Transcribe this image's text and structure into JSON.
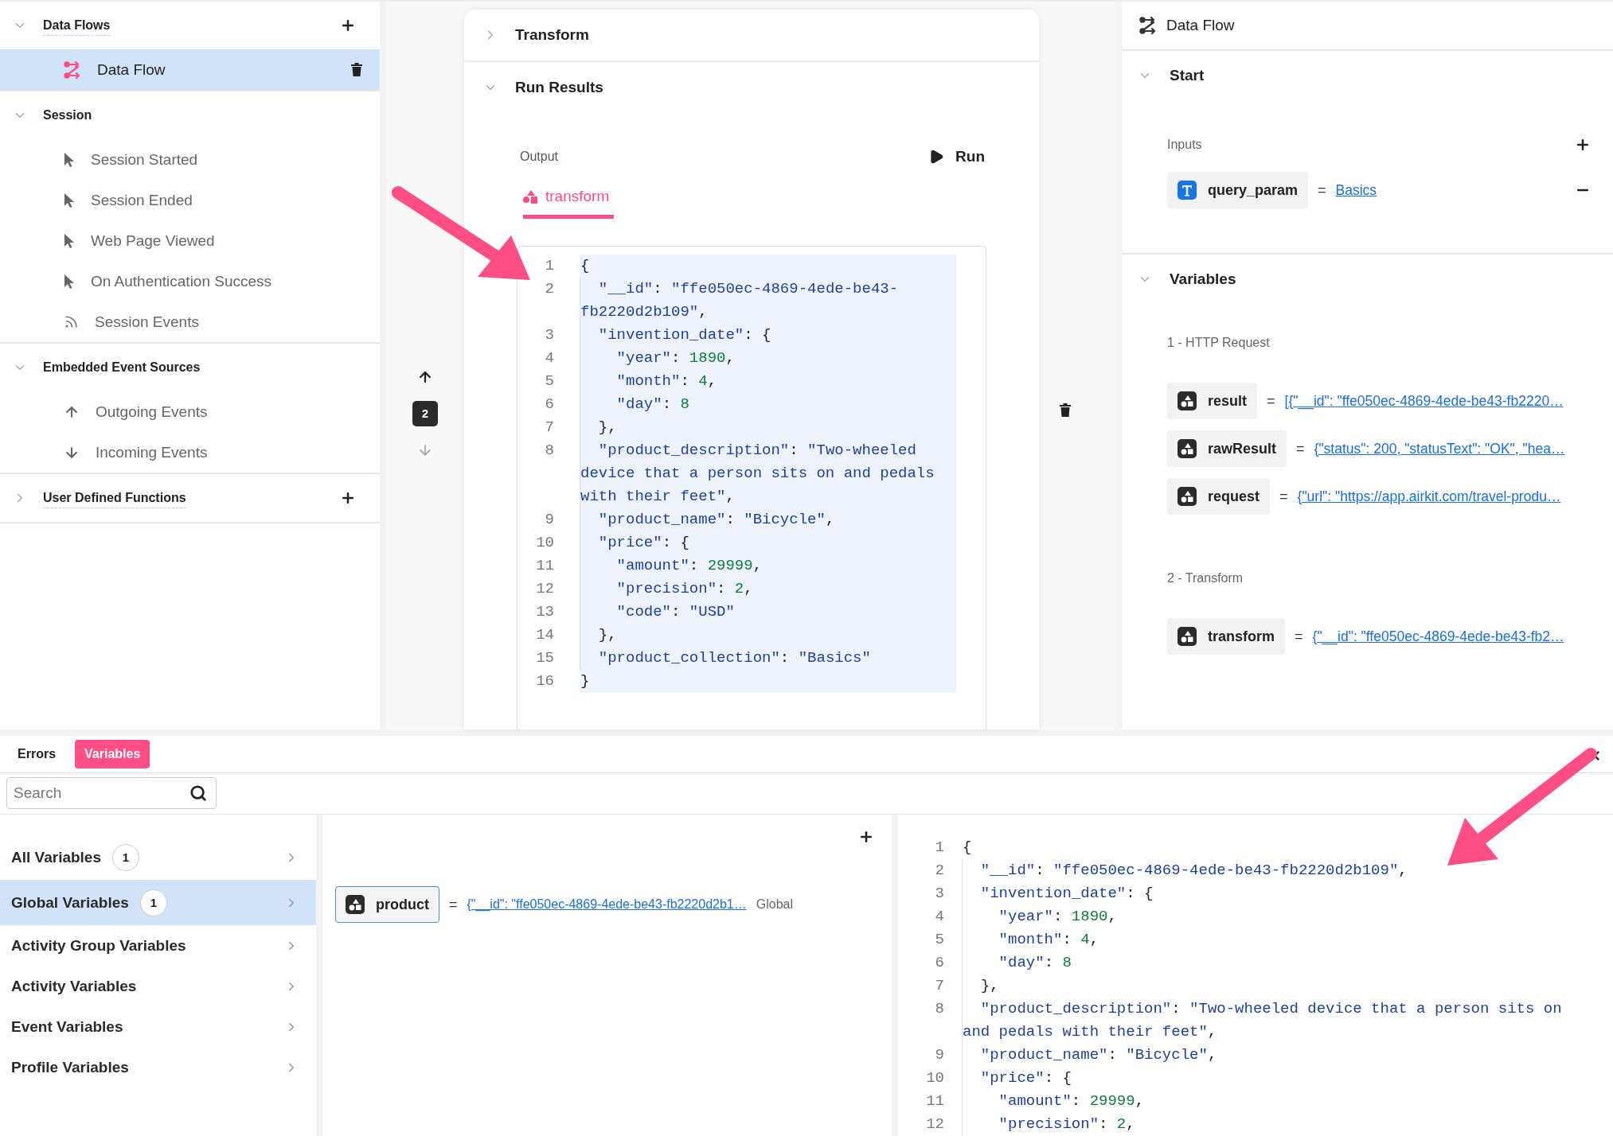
{
  "sidebar": {
    "sections": [
      {
        "title": "Data Flows",
        "expanded": true,
        "addable": true,
        "items": [
          {
            "label": "Data Flow",
            "kind": "flow",
            "selected": true
          }
        ]
      },
      {
        "title": "Session",
        "expanded": true,
        "addable": false,
        "items": [
          {
            "label": "Session Started",
            "kind": "cursor",
            "selected": false
          },
          {
            "label": "Session Ended",
            "kind": "cursor",
            "selected": false
          },
          {
            "label": "Web Page Viewed",
            "kind": "cursor",
            "selected": false
          },
          {
            "label": "On Authentication Success",
            "kind": "cursor",
            "selected": false
          },
          {
            "label": "Session Events",
            "kind": "feed",
            "selected": false
          }
        ]
      },
      {
        "title": "Embedded Event Sources",
        "expanded": true,
        "addable": false,
        "items": [
          {
            "label": "Outgoing Events",
            "kind": "up",
            "selected": false
          },
          {
            "label": "Incoming Events",
            "kind": "down",
            "selected": false
          }
        ]
      },
      {
        "title": "User Defined Functions",
        "expanded": false,
        "addable": true
      }
    ]
  },
  "center": {
    "step": "2",
    "sections": [
      {
        "title": "Transform",
        "expanded": false
      },
      {
        "title": "Run Results",
        "expanded": true
      }
    ],
    "output_label": "Output",
    "run_button": "Run",
    "tabs": [
      {
        "label": "transform",
        "selected": true
      }
    ],
    "code": [
      {
        "number": "1",
        "tokens": [
          {
            "kind": "punct",
            "text": "{"
          }
        ]
      },
      {
        "number": "2",
        "tokens": [
          {
            "kind": "key",
            "text": "  \"__id\""
          },
          {
            "kind": "punct",
            "text": ": "
          },
          {
            "kind": "string",
            "text": "\"ffe050ec-4869-4ede-be43-fb2220d2b109\""
          },
          {
            "kind": "punct",
            "text": ","
          }
        ]
      },
      {
        "number": "3",
        "tokens": [
          {
            "kind": "key",
            "text": "  \"invention_date\""
          },
          {
            "kind": "punct",
            "text": ": {"
          }
        ]
      },
      {
        "number": "4",
        "tokens": [
          {
            "kind": "key",
            "text": "    \"year\""
          },
          {
            "kind": "punct",
            "text": ": "
          },
          {
            "kind": "number",
            "text": "1890"
          },
          {
            "kind": "punct",
            "text": ","
          }
        ]
      },
      {
        "number": "5",
        "tokens": [
          {
            "kind": "key",
            "text": "    \"month\""
          },
          {
            "kind": "punct",
            "text": ": "
          },
          {
            "kind": "number",
            "text": "4"
          },
          {
            "kind": "punct",
            "text": ","
          }
        ]
      },
      {
        "number": "6",
        "tokens": [
          {
            "kind": "key",
            "text": "    \"day\""
          },
          {
            "kind": "punct",
            "text": ": "
          },
          {
            "kind": "number",
            "text": "8"
          }
        ]
      },
      {
        "number": "7",
        "tokens": [
          {
            "kind": "punct",
            "text": "  },"
          }
        ]
      },
      {
        "number": "8",
        "tokens": [
          {
            "kind": "key",
            "text": "  \"product_description\""
          },
          {
            "kind": "punct",
            "text": ": "
          },
          {
            "kind": "string",
            "text": "\"Two-wheeled device that a person sits on and pedals with their feet\""
          },
          {
            "kind": "punct",
            "text": ","
          }
        ]
      },
      {
        "number": "9",
        "tokens": [
          {
            "kind": "key",
            "text": "  \"product_name\""
          },
          {
            "kind": "punct",
            "text": ": "
          },
          {
            "kind": "string",
            "text": "\"Bicycle\""
          },
          {
            "kind": "punct",
            "text": ","
          }
        ]
      },
      {
        "number": "10",
        "tokens": [
          {
            "kind": "key",
            "text": "  \"price\""
          },
          {
            "kind": "punct",
            "text": ": {"
          }
        ]
      },
      {
        "number": "11",
        "tokens": [
          {
            "kind": "key",
            "text": "    \"amount\""
          },
          {
            "kind": "punct",
            "text": ": "
          },
          {
            "kind": "number",
            "text": "29999"
          },
          {
            "kind": "punct",
            "text": ","
          }
        ]
      },
      {
        "number": "12",
        "tokens": [
          {
            "kind": "key",
            "text": "    \"precision\""
          },
          {
            "kind": "punct",
            "text": ": "
          },
          {
            "kind": "number",
            "text": "2"
          },
          {
            "kind": "punct",
            "text": ","
          }
        ]
      },
      {
        "number": "13",
        "tokens": [
          {
            "kind": "key",
            "text": "    \"code\""
          },
          {
            "kind": "punct",
            "text": ": "
          },
          {
            "kind": "string",
            "text": "\"USD\""
          }
        ]
      },
      {
        "number": "14",
        "tokens": [
          {
            "kind": "punct",
            "text": "  },"
          }
        ]
      },
      {
        "number": "15",
        "tokens": [
          {
            "kind": "key",
            "text": "  \"product_collection\""
          },
          {
            "kind": "punct",
            "text": ": "
          },
          {
            "kind": "string",
            "text": "\"Basics\""
          }
        ]
      },
      {
        "number": "16",
        "tokens": [
          {
            "kind": "punct",
            "text": "}"
          }
        ]
      }
    ]
  },
  "right": {
    "title": "Data Flow",
    "start": {
      "title": "Start",
      "expanded": true,
      "inputs_label": "Inputs",
      "inputs": [
        {
          "name": "query_param",
          "kind": "text",
          "operator": "=",
          "value": "Basics"
        }
      ]
    },
    "variables": {
      "title": "Variables",
      "expanded": true,
      "groups": [
        {
          "title": "1 - HTTP Request",
          "items": [
            {
              "name": "result",
              "kind": "object",
              "operator": "=",
              "value": "[{\"__id\": \"ffe050ec-4869-4ede-be43-fb2220…"
            },
            {
              "name": "rawResult",
              "kind": "object",
              "operator": "=",
              "value": "{\"status\": 200, \"statusText\": \"OK\", \"hea…"
            },
            {
              "name": "request",
              "kind": "object",
              "operator": "=",
              "value": "{\"url\": \"https://app.airkit.com/travel-produ…"
            }
          ]
        },
        {
          "title": "2 - Transform",
          "items": [
            {
              "name": "transform",
              "kind": "object",
              "operator": "=",
              "value": "{\"__id\": \"ffe050ec-4869-4ede-be43-fb2…"
            }
          ]
        }
      ]
    }
  },
  "bottom": {
    "tabs": [
      {
        "label": "Errors",
        "selected": false
      },
      {
        "label": "Variables",
        "selected": true
      }
    ],
    "search": {
      "placeholder": "Search"
    },
    "categories": [
      {
        "label": "All Variables",
        "count": "1",
        "selected": false
      },
      {
        "label": "Global Variables",
        "count": "1",
        "selected": true
      },
      {
        "label": "Activity Group Variables",
        "selected": false
      },
      {
        "label": "Activity Variables",
        "selected": false
      },
      {
        "label": "Event Variables",
        "selected": false
      },
      {
        "label": "Profile Variables",
        "selected": false
      }
    ],
    "variables": [
      {
        "name": "product",
        "kind": "object",
        "operator": "=",
        "value": "{\"__id\": \"ffe050ec-4869-4ede-be43-fb2220d2b1…",
        "scope": "Global"
      }
    ],
    "code": [
      {
        "number": "1",
        "tokens": [
          {
            "kind": "punct",
            "text": "{"
          }
        ]
      },
      {
        "number": "2",
        "tokens": [
          {
            "kind": "key",
            "text": "  \"__id\""
          },
          {
            "kind": "punct",
            "text": ": "
          },
          {
            "kind": "string",
            "text": "\"ffe050ec-4869-4ede-be43-fb2220d2b109\""
          },
          {
            "kind": "punct",
            "text": ","
          }
        ]
      },
      {
        "number": "3",
        "tokens": [
          {
            "kind": "key",
            "text": "  \"invention_date\""
          },
          {
            "kind": "punct",
            "text": ": {"
          }
        ]
      },
      {
        "number": "4",
        "tokens": [
          {
            "kind": "key",
            "text": "    \"year\""
          },
          {
            "kind": "punct",
            "text": ": "
          },
          {
            "kind": "number",
            "text": "1890"
          },
          {
            "kind": "punct",
            "text": ","
          }
        ]
      },
      {
        "number": "5",
        "tokens": [
          {
            "kind": "key",
            "text": "    \"month\""
          },
          {
            "kind": "punct",
            "text": ": "
          },
          {
            "kind": "number",
            "text": "4"
          },
          {
            "kind": "punct",
            "text": ","
          }
        ]
      },
      {
        "number": "6",
        "tokens": [
          {
            "kind": "key",
            "text": "    \"day\""
          },
          {
            "kind": "punct",
            "text": ": "
          },
          {
            "kind": "number",
            "text": "8"
          }
        ]
      },
      {
        "number": "7",
        "tokens": [
          {
            "kind": "punct",
            "text": "  },"
          }
        ]
      },
      {
        "number": "8",
        "tokens": [
          {
            "kind": "key",
            "text": "  \"product_description\""
          },
          {
            "kind": "punct",
            "text": ": "
          },
          {
            "kind": "string",
            "text": "\"Two-wheeled device that a person sits on and pedals with their feet\""
          },
          {
            "kind": "punct",
            "text": ","
          }
        ]
      },
      {
        "number": "9",
        "tokens": [
          {
            "kind": "key",
            "text": "  \"product_name\""
          },
          {
            "kind": "punct",
            "text": ": "
          },
          {
            "kind": "string",
            "text": "\"Bicycle\""
          },
          {
            "kind": "punct",
            "text": ","
          }
        ]
      },
      {
        "number": "10",
        "tokens": [
          {
            "kind": "key",
            "text": "  \"price\""
          },
          {
            "kind": "punct",
            "text": ": {"
          }
        ]
      },
      {
        "number": "11",
        "tokens": [
          {
            "kind": "key",
            "text": "    \"amount\""
          },
          {
            "kind": "punct",
            "text": ": "
          },
          {
            "kind": "number",
            "text": "29999"
          },
          {
            "kind": "punct",
            "text": ","
          }
        ]
      },
      {
        "number": "12",
        "tokens": [
          {
            "kind": "key",
            "text": "    \"precision\""
          },
          {
            "kind": "punct",
            "text": ": "
          },
          {
            "kind": "number",
            "text": "2"
          },
          {
            "kind": "punct",
            "text": ","
          }
        ]
      }
    ]
  }
}
